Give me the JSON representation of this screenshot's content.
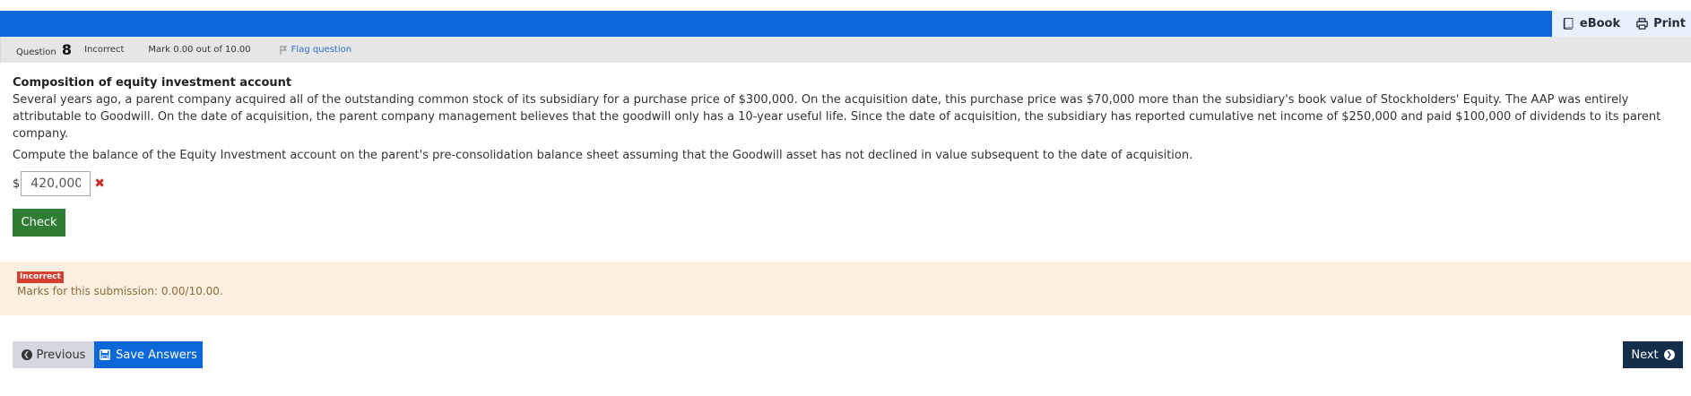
{
  "toolbar": {
    "ebook_label": "eBook",
    "print_label": "Print"
  },
  "info": {
    "question_prefix": "Question",
    "question_number": "8",
    "state": "Incorrect",
    "mark": "Mark 0.00 out of 10.00",
    "flag_label": "Flag question"
  },
  "question": {
    "title": "Composition of equity investment account",
    "text": "Several years ago, a parent company acquired all of the outstanding common stock of its subsidiary for a purchase price of $300,000. On the acquisition date, this purchase price was $70,000 more than the subsidiary's book value of Stockholders' Equity. The AAP was entirely attributable to Goodwill. On the date of acquisition, the parent company management believes that the goodwill only has a 10-year useful life. Since the date of acquisition, the subsidiary has reported cumulative net income of $250,000 and paid $100,000 of dividends to its parent company.",
    "task": "Compute the balance of the Equity Investment account on the parent's pre-consolidation balance sheet assuming that the Goodwill asset has not declined in value subsequent to the date of acquisition.",
    "currency": "$",
    "answer_value": "420,000",
    "check_label": "Check"
  },
  "feedback": {
    "badge": "Incorrect",
    "marks_text": "Marks for this submission: 0.00/10.00."
  },
  "nav": {
    "previous_label": "Previous",
    "save_label": "Save Answers",
    "next_label": "Next"
  },
  "colors": {
    "header_blue": "#0c68d9",
    "check_green": "#2f7d32",
    "incorrect_red": "#d43f2f",
    "feedback_bg": "#fcefdf",
    "next_navy": "#142e4a"
  }
}
